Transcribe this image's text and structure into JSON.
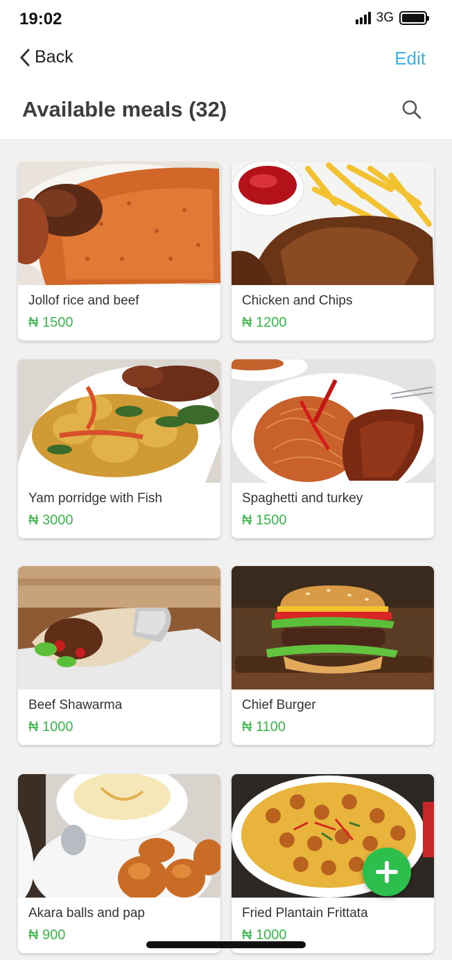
{
  "status_bar": {
    "time": "19:02",
    "network": "3G"
  },
  "nav": {
    "back_label": "Back",
    "edit_label": "Edit"
  },
  "page": {
    "title": "Available meals (32)"
  },
  "meals": [
    {
      "name": "Jollof rice and beef",
      "price": "₦ 1500"
    },
    {
      "name": "Chicken and Chips",
      "price": "₦ 1200"
    },
    {
      "name": "Yam porridge with Fish",
      "price": "₦ 3000"
    },
    {
      "name": "Spaghetti and turkey",
      "price": "₦ 1500"
    },
    {
      "name": "Beef Shawarma",
      "price": "₦ 1000"
    },
    {
      "name": "Chief Burger",
      "price": "₦ 1100"
    },
    {
      "name": "Akara balls and pap",
      "price": "₦ 900"
    },
    {
      "name": "Fried Plantain Frittata",
      "price": "₦ 1000"
    }
  ],
  "colors": {
    "accent": "#3eb1e3",
    "price": "#39b54a",
    "fab": "#2cbf4c"
  },
  "icons": {
    "back": "chevron-left-icon",
    "search": "search-icon",
    "add": "plus-icon"
  }
}
